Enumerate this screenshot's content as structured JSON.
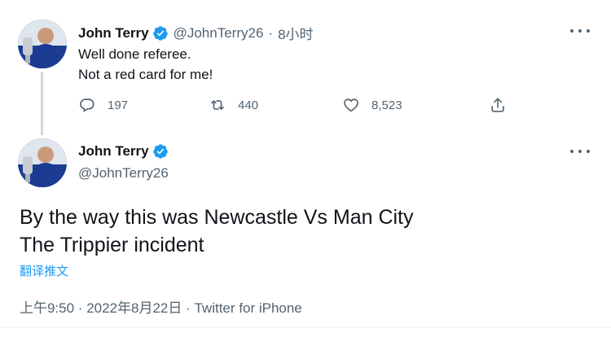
{
  "tweet1": {
    "name": "John Terry",
    "handle": "@JohnTerry26",
    "separator": "·",
    "time": "8小时",
    "line1": "Well done referee.",
    "line2": "Not a red card for me!",
    "replies": "197",
    "retweets": "440",
    "likes": "8,523"
  },
  "tweet2": {
    "name": "John Terry",
    "handle": "@JohnTerry26",
    "line1": "By the way this was Newcastle Vs Man City",
    "line2": "The Trippier incident",
    "translate_label": "翻译推文",
    "timestamp": "上午9:50 · 2022年8月22日 · Twitter for iPhone"
  },
  "colors": {
    "verified": "#1d9bf0",
    "link": "#1d9bf0",
    "secondary_text": "#536471",
    "avatar_kit": "#1d3d8f"
  },
  "icons": [
    "verified-badge-icon",
    "more-icon",
    "reply-icon",
    "retweet-icon",
    "like-icon",
    "share-icon"
  ]
}
